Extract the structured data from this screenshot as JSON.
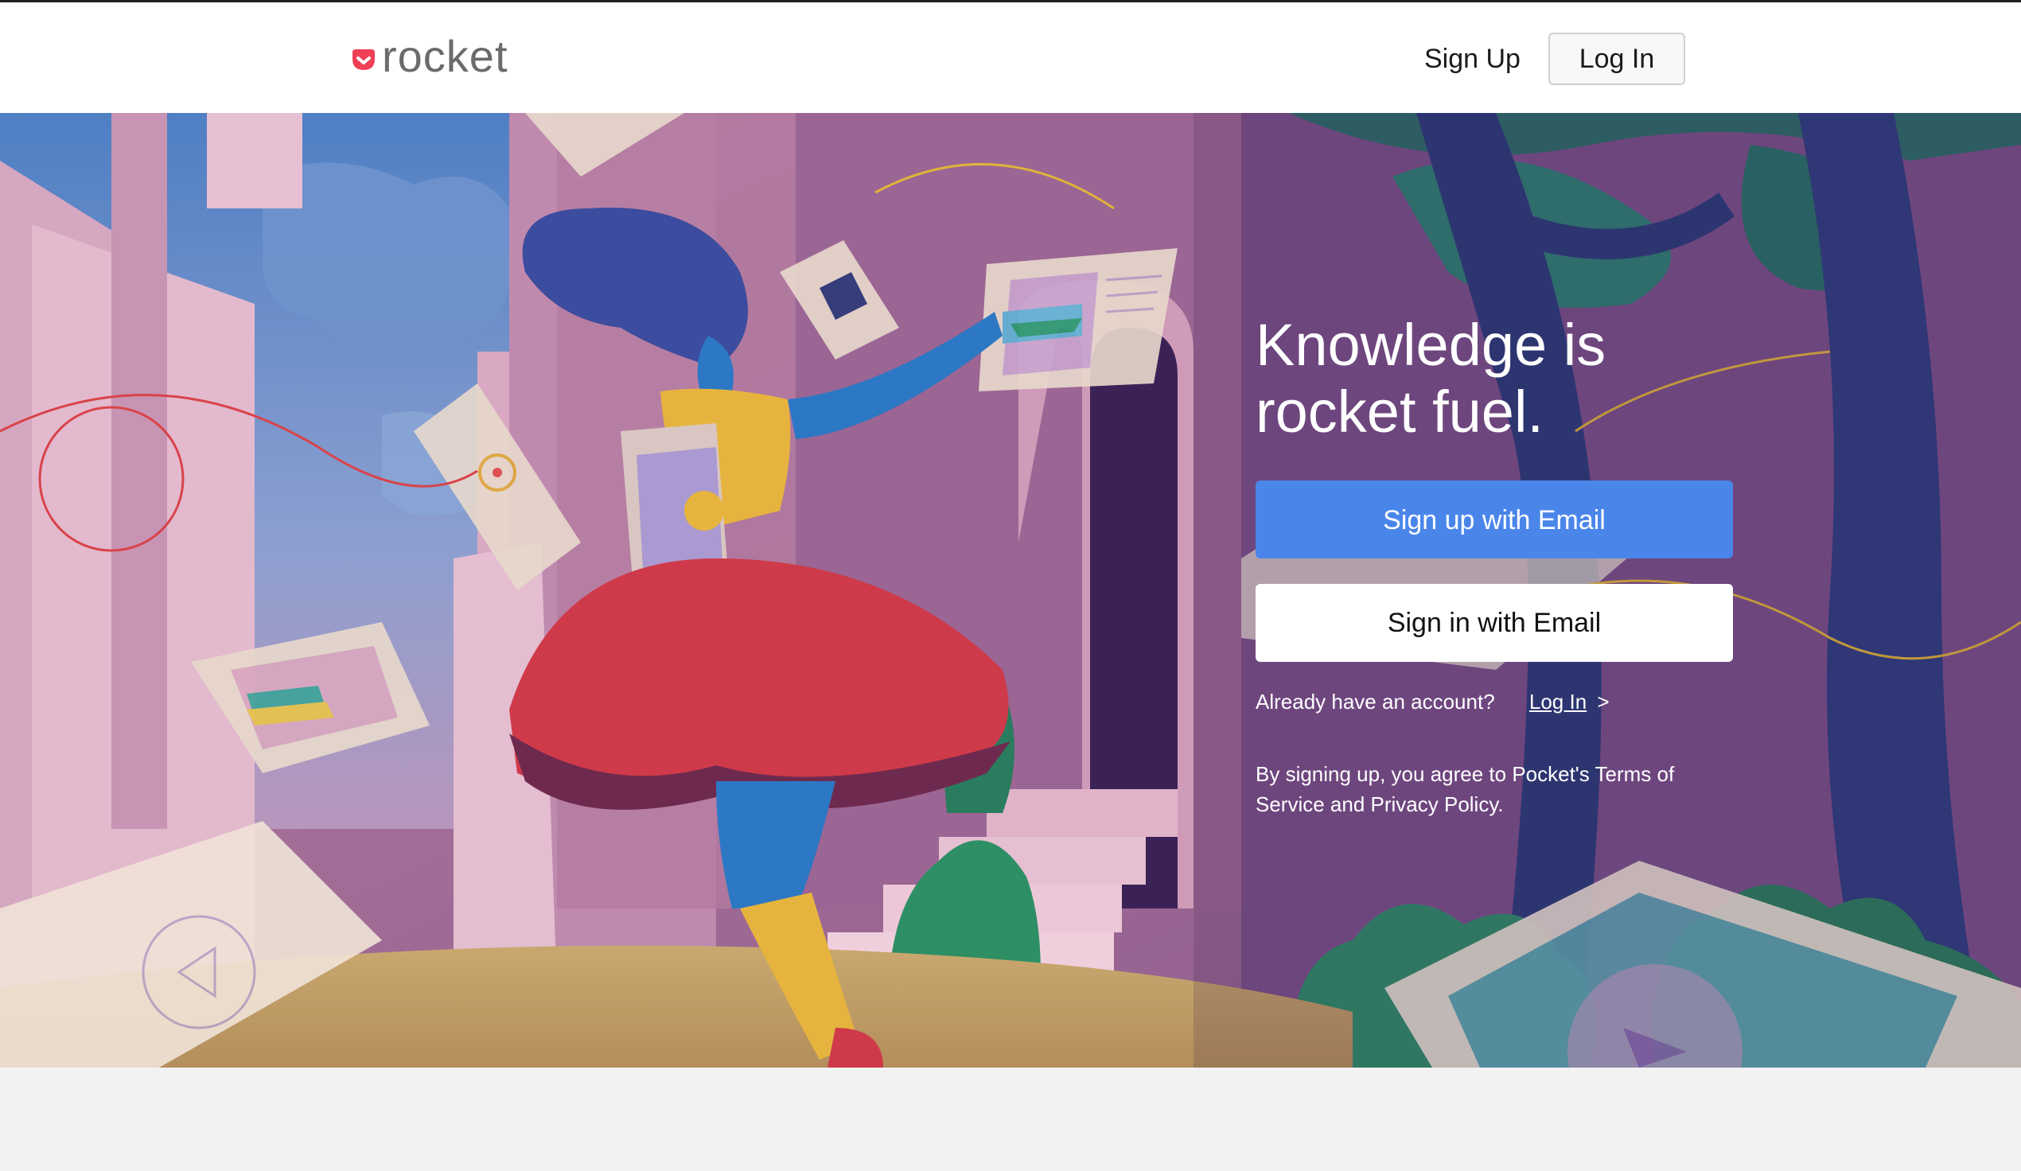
{
  "header": {
    "logo_text": "rocket",
    "signup_label": "Sign Up",
    "login_label": "Log In"
  },
  "hero": {
    "title_line1": "Knowledge is",
    "title_line2": "rocket fuel.",
    "signup_email_label": "Sign up with Email",
    "signin_email_label": "Sign in with Email",
    "already_text": "Already have an account?",
    "login_link": "Log In",
    "login_chevron": ">",
    "terms_text": "By signing up, you agree to Pocket's Terms of Service and Privacy Policy."
  },
  "colors": {
    "brand": "#ef4056",
    "primary_button": "#4a86ea",
    "hero_bg": "#a7749a"
  },
  "icons": [
    "rocket-logo-icon",
    "hero-illustration"
  ]
}
